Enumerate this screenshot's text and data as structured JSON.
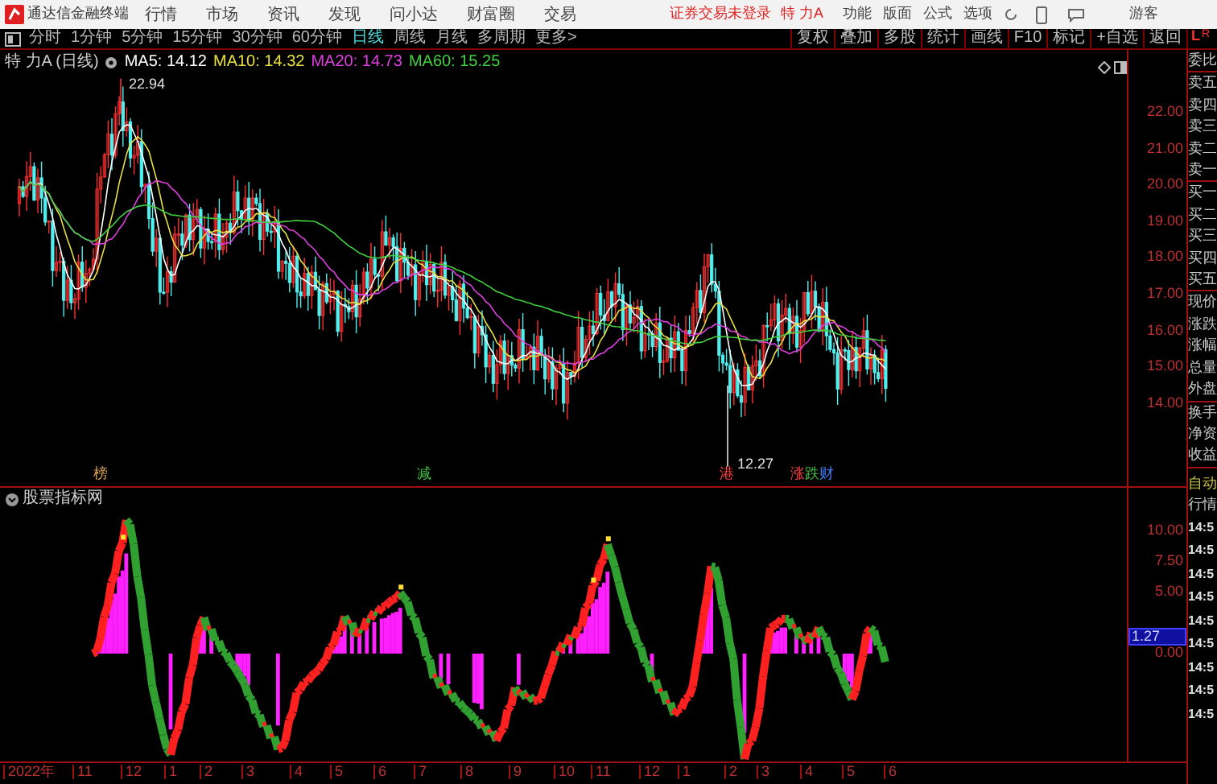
{
  "app": {
    "title": "通达信金融终端"
  },
  "menu": [
    "行情",
    "市场",
    "资讯",
    "发现",
    "问小达",
    "财富圈",
    "交易"
  ],
  "login_status": "证券交易未登录",
  "stock_name": "特 力A",
  "right_menu": [
    "功能",
    "版面",
    "公式",
    "选项"
  ],
  "user": "游客",
  "periods": [
    {
      "label": "分时",
      "selected": false
    },
    {
      "label": "1分钟",
      "selected": false
    },
    {
      "label": "5分钟",
      "selected": false
    },
    {
      "label": "15分钟",
      "selected": false
    },
    {
      "label": "30分钟",
      "selected": false
    },
    {
      "label": "60分钟",
      "selected": false
    },
    {
      "label": "日线",
      "selected": true
    },
    {
      "label": "周线",
      "selected": false
    },
    {
      "label": "月线",
      "selected": false
    },
    {
      "label": "多周期",
      "selected": false
    },
    {
      "label": "更多>",
      "selected": false
    }
  ],
  "tools": [
    "复权",
    "叠加",
    "多股",
    "统计",
    "画线",
    "F10",
    "标记",
    "+自选",
    "返回"
  ],
  "panel_switch": [
    {
      "label": "L",
      "selected": true
    },
    {
      "label": "R",
      "selected": true
    }
  ],
  "chart": {
    "title": "特 力A (日线)",
    "ma": [
      {
        "label": "MA5: 14.12",
        "color": "#ffffff"
      },
      {
        "label": "MA10: 14.32",
        "color": "#e8e040"
      },
      {
        "label": "MA20: 14.73",
        "color": "#e040e0"
      },
      {
        "label": "MA60: 15.25",
        "color": "#40d040"
      }
    ],
    "price_axis": [
      "22.00",
      "21.00",
      "20.00",
      "19.00",
      "18.00",
      "17.00",
      "16.00",
      "15.00",
      "14.00"
    ],
    "high_label": "22.94",
    "low_label": "12.27",
    "events": [
      {
        "label": "榜",
        "color": "#d8a050"
      },
      {
        "label": "减",
        "color": "#40c040"
      },
      {
        "label": "港",
        "color": "#ff4040"
      },
      {
        "label": "涨",
        "color": "#ff4040"
      },
      {
        "label": "跌",
        "color": "#40c040"
      },
      {
        "label": "财",
        "color": "#4080ff"
      }
    ]
  },
  "indicator": {
    "title": "股票指标网",
    "axis": [
      "10.00",
      "7.50",
      "5.00",
      "0.00"
    ],
    "cursor_value": "1.27"
  },
  "date_axis": [
    "2022年",
    "11",
    "12",
    "1",
    "2",
    "3",
    "4",
    "5",
    "6",
    "7",
    "8",
    "9",
    "10",
    "11",
    "12",
    "1",
    "2",
    "3",
    "4",
    "5",
    "6"
  ],
  "quote_panel": {
    "groups": [
      [
        "委比"
      ],
      [
        "卖五",
        "卖四",
        "卖三",
        "卖二",
        "卖一"
      ],
      [
        "买一",
        "买二",
        "买三",
        "买四",
        "买五"
      ],
      [
        "现价",
        "涨跌",
        "涨幅",
        "总量",
        "外盘"
      ],
      [
        "换手",
        "净资",
        "收益"
      ]
    ],
    "mode": "自动",
    "tick_header": "行情",
    "ticks": [
      "14:5",
      "14:5",
      "14:5",
      "14:5",
      "14:5",
      "14:5",
      "14:5",
      "14:5",
      "14:5"
    ]
  }
}
